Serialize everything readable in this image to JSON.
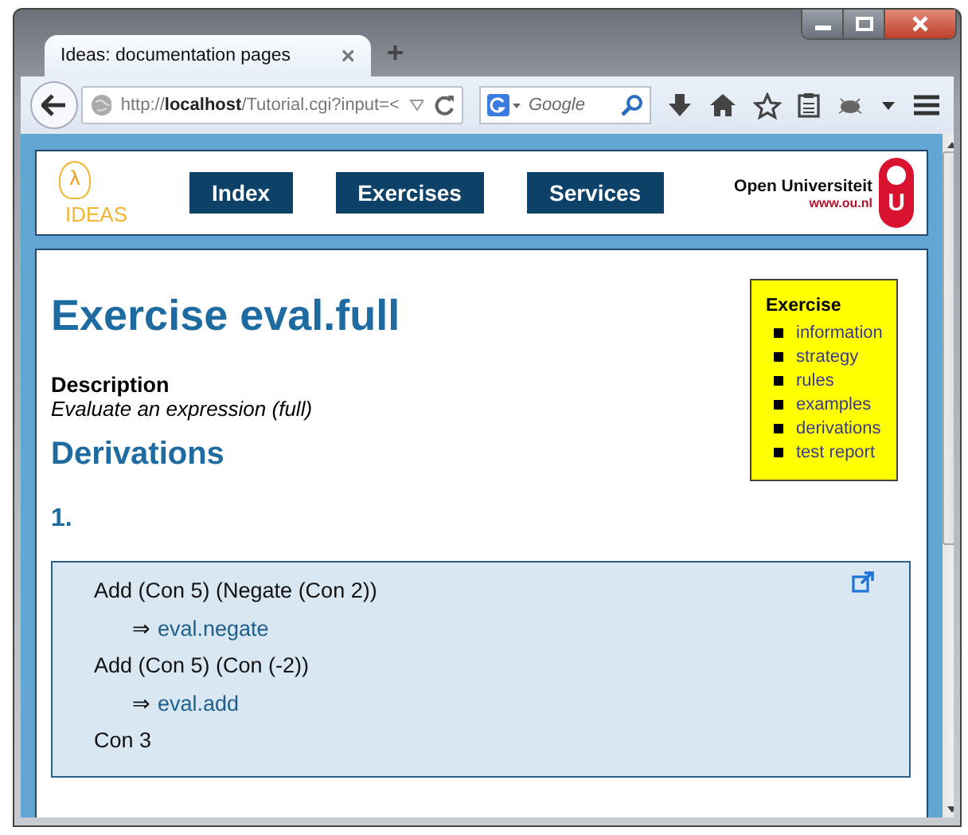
{
  "browser": {
    "tab": {
      "title": "Ideas: documentation pages",
      "close": "×"
    },
    "new_tab": "+",
    "url": {
      "scheme": "http://",
      "host": "localhost",
      "path": "/Tutorial.cgi?input=<"
    },
    "search": {
      "placeholder": "Google"
    }
  },
  "header": {
    "logo": {
      "symbol": "λ",
      "text": "IDEAS"
    },
    "nav": [
      "Index",
      "Exercises",
      "Services"
    ],
    "university": {
      "name": "Open Universiteit",
      "url": "www.ou.nl",
      "mark": "U"
    }
  },
  "sidebar": {
    "title": "Exercise",
    "links": [
      "information",
      "strategy",
      "rules",
      "examples",
      "derivations",
      "test report"
    ]
  },
  "page": {
    "title": "Exercise eval.full",
    "description_label": "Description",
    "description": "Evaluate an expression (full)",
    "section": "Derivations",
    "number": "1.",
    "steps": [
      {
        "kind": "term",
        "text": "Add (Con 5) (Negate (Con 2))"
      },
      {
        "kind": "rule",
        "arrow": "⇒",
        "text": "eval.negate"
      },
      {
        "kind": "term",
        "text": "Add (Con 5) (Con (-2))"
      },
      {
        "kind": "rule",
        "arrow": "⇒",
        "text": "eval.add"
      },
      {
        "kind": "term",
        "text": "Con 3"
      }
    ]
  }
}
